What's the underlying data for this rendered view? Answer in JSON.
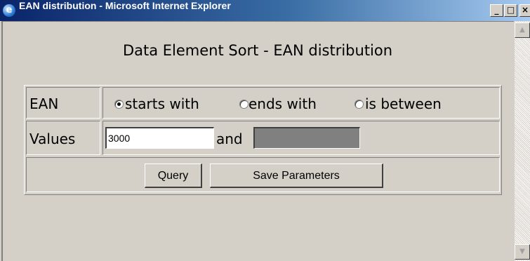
{
  "window": {
    "title": "EAN distribution - Microsoft Internet Explorer",
    "controls": {
      "minimize": "_",
      "maximize": "□",
      "close": "×"
    }
  },
  "page": {
    "heading": "Data Element Sort - EAN distribution"
  },
  "form": {
    "ean_label": "EAN",
    "radio_options": [
      {
        "label": "starts with",
        "checked": true
      },
      {
        "label": "ends with",
        "checked": false
      },
      {
        "label": "is between",
        "checked": false
      }
    ],
    "values_label": "Values",
    "value_from": "3000",
    "and_label": "and",
    "value_to": "",
    "query_button": "Query",
    "save_button": "Save Parameters"
  },
  "scrollbar": {
    "up_arrow": "▲",
    "down_arrow": "▼"
  },
  "colors": {
    "titlebar_start": "#0a246a",
    "titlebar_end": "#a6caf0",
    "face": "#d4d0c8",
    "disabled_field": "#808080"
  }
}
